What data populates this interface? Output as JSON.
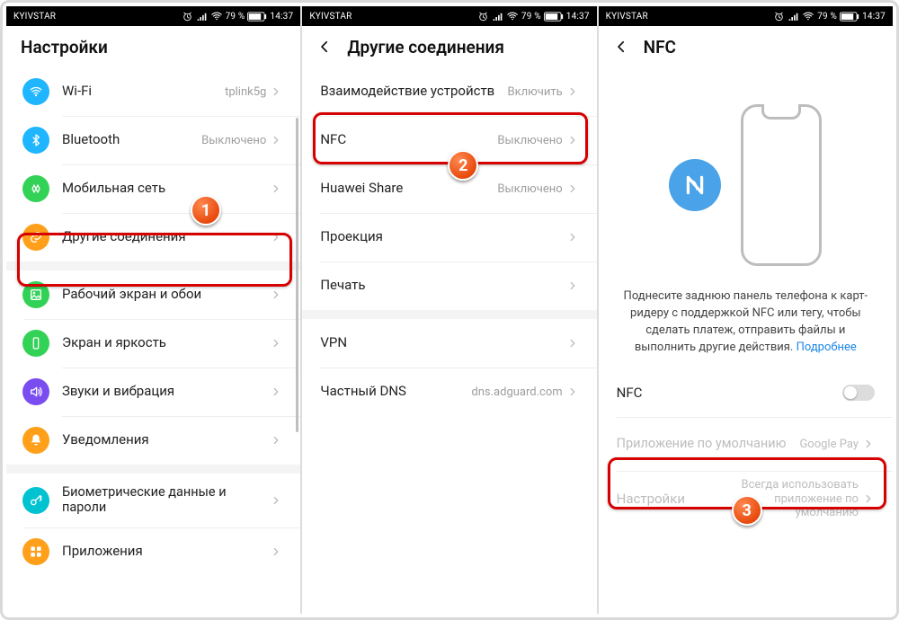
{
  "status": {
    "carrier": "KYIVSTAR",
    "battery": "79 %",
    "time": "14:37"
  },
  "screen1": {
    "title": "Настройки",
    "items": [
      {
        "name": "wifi",
        "label": "Wi-Fi",
        "value": "tplink5g",
        "color": "#1fb6ff"
      },
      {
        "name": "bluetooth",
        "label": "Bluetooth",
        "value": "Выключено",
        "color": "#1fb6ff"
      },
      {
        "name": "mobile",
        "label": "Мобильная сеть",
        "value": "",
        "color": "#32d257"
      },
      {
        "name": "other-conn",
        "label": "Другие соединения",
        "value": "",
        "color": "#ff9f1a"
      },
      {
        "name": "home-wallpaper",
        "label": "Рабочий экран и обои",
        "value": "",
        "color": "#32d257"
      },
      {
        "name": "display",
        "label": "Экран и яркость",
        "value": "",
        "color": "#32d257"
      },
      {
        "name": "sounds",
        "label": "Звуки и вибрация",
        "value": "",
        "color": "#7a4df0"
      },
      {
        "name": "notifications",
        "label": "Уведомления",
        "value": "",
        "color": "#ff9f1a"
      },
      {
        "name": "biometrics",
        "label": "Биометрические данные и пароли",
        "value": "",
        "color": "#00c2d1"
      },
      {
        "name": "apps",
        "label": "Приложения",
        "value": "",
        "color": "#ff9f1a"
      }
    ]
  },
  "screen2": {
    "title": "Другие соединения",
    "groupA": [
      {
        "name": "device-interact",
        "label": "Взаимодействие устройств",
        "value": "Включить"
      },
      {
        "name": "nfc",
        "label": "NFC",
        "value": "Выключено"
      },
      {
        "name": "huawei-share",
        "label": "Huawei Share",
        "value": "Выключено"
      },
      {
        "name": "projection",
        "label": "Проекция",
        "value": ""
      },
      {
        "name": "print",
        "label": "Печать",
        "value": ""
      }
    ],
    "groupB": [
      {
        "name": "vpn",
        "label": "VPN",
        "value": ""
      },
      {
        "name": "dns",
        "label": "Частный DNS",
        "value": "dns.adguard.com"
      }
    ]
  },
  "screen3": {
    "title": "NFC",
    "description": "Поднесите заднюю панель телефона к карт-ридеру с поддержкой NFC или тегу, чтобы сделать платеж, отправить файлы и выполнить другие действия.",
    "more": "Подробнее",
    "rows": {
      "nfc_toggle": "NFC",
      "default_app_label": "Приложение по умолчанию",
      "default_app_value": "Google Pay",
      "settings_label": "Настройки",
      "settings_value": "Всегда использовать приложение по умолчанию"
    }
  },
  "badges": {
    "n1": "1",
    "n2": "2",
    "n3": "3"
  }
}
